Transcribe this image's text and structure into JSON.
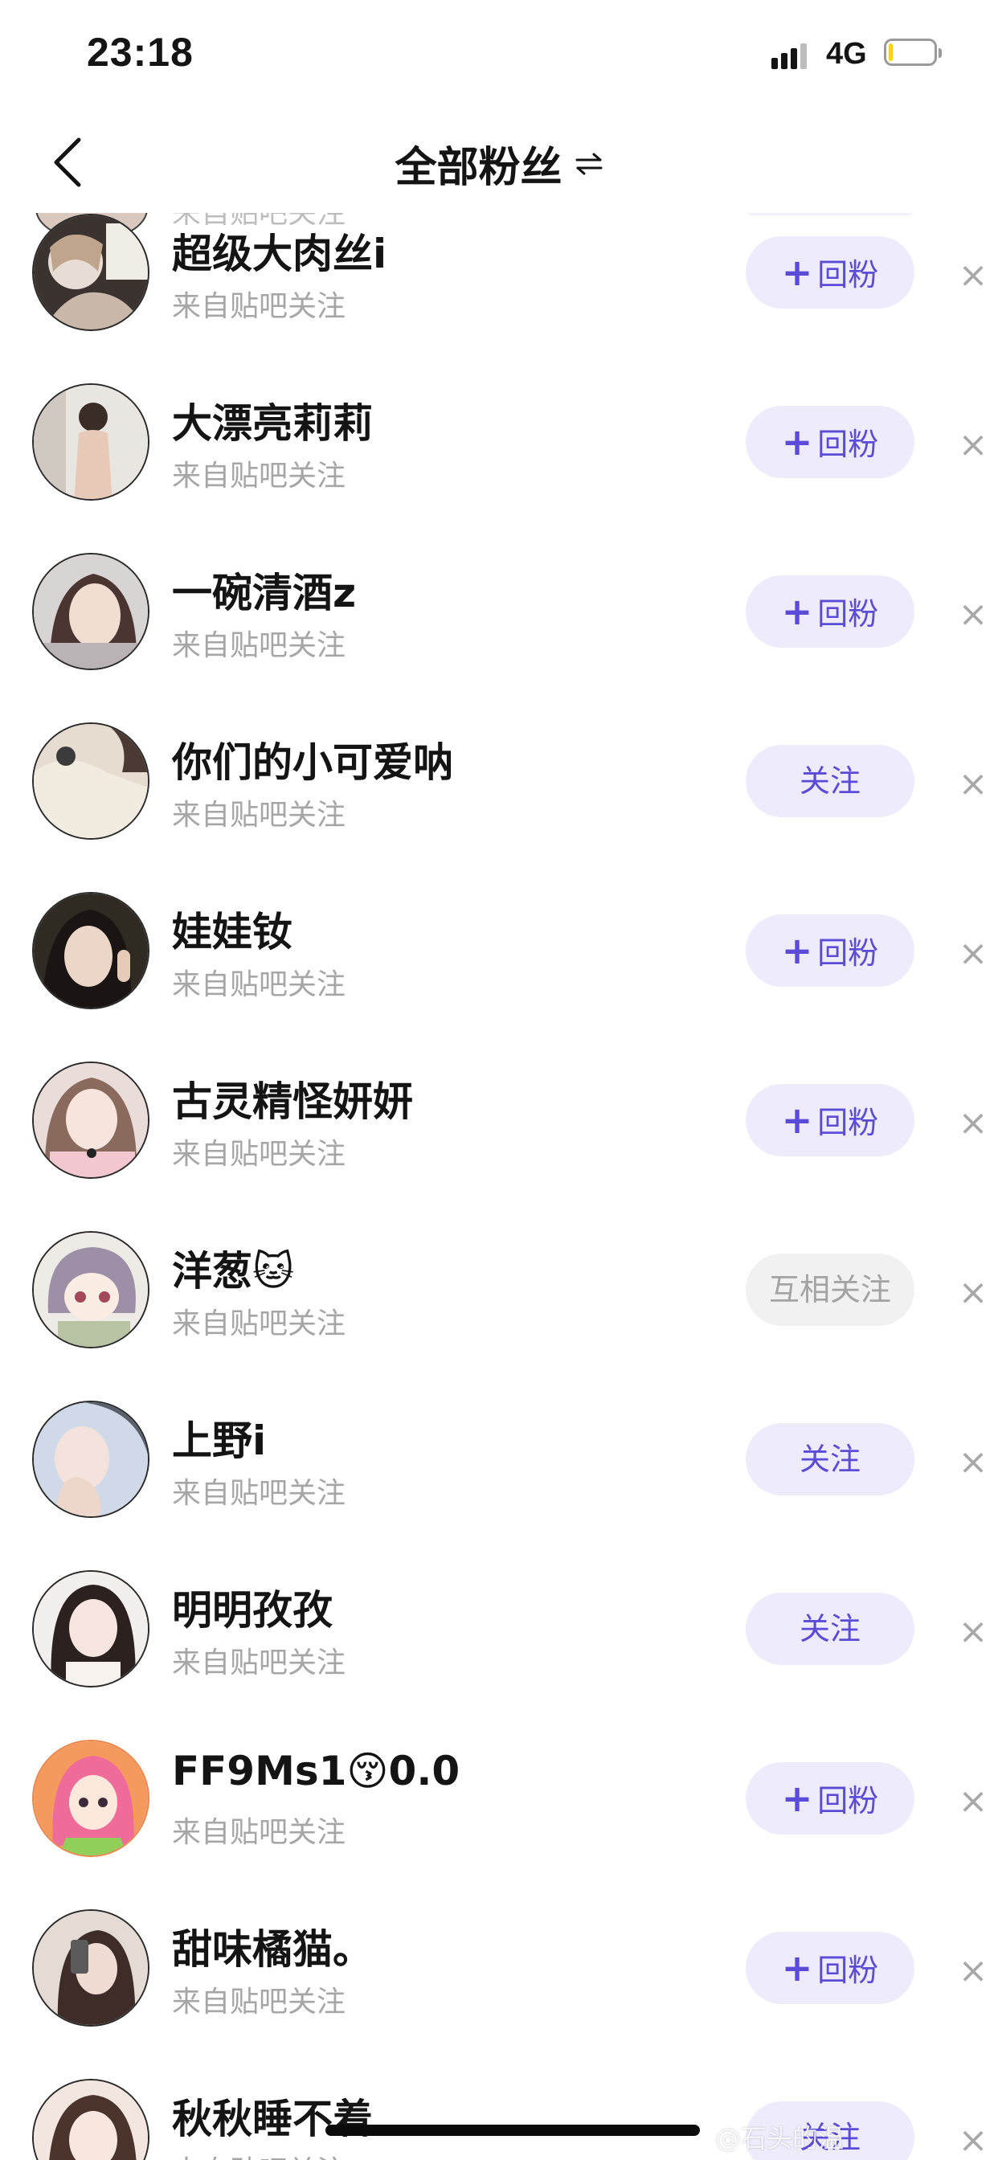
{
  "status_bar": {
    "time": "23:18",
    "network": "4G",
    "battery_level": 0.1,
    "battery_color": "#f3d51f"
  },
  "nav": {
    "back_icon": "chevron-left-icon",
    "title": "全部粉丝",
    "switch_icon": "swap-arrows-icon"
  },
  "colors": {
    "accent": "#5b4bd6",
    "button_bg": "#eeebfc",
    "mutual_bg": "#f1f1f1",
    "mutual_text": "#a3a3a3",
    "secondary_text": "#a6a6a6"
  },
  "followers": [
    {
      "name": "超级大肉丝i",
      "source": "来自贴吧关注",
      "action": "回粉",
      "action_type": "follow-back",
      "remove": "×"
    },
    {
      "name": "大漂亮莉莉",
      "source": "来自贴吧关注",
      "action": "回粉",
      "action_type": "follow-back",
      "remove": "×"
    },
    {
      "name": "一碗清酒z",
      "source": "来自贴吧关注",
      "action": "回粉",
      "action_type": "follow-back",
      "remove": "×"
    },
    {
      "name": "你们的小可爱呐",
      "source": "来自贴吧关注",
      "action": "关注",
      "action_type": "follow",
      "remove": "×"
    },
    {
      "name": "娃娃钕",
      "source": "来自贴吧关注",
      "action": "回粉",
      "action_type": "follow-back",
      "remove": "×"
    },
    {
      "name": "古灵精怪妍妍",
      "source": "来自贴吧关注",
      "action": "回粉",
      "action_type": "follow-back",
      "remove": "×"
    },
    {
      "name": "洋葱🐱",
      "source": "来自贴吧关注",
      "action": "互相关注",
      "action_type": "mutual",
      "remove": "×"
    },
    {
      "name": "上野i",
      "source": "来自贴吧关注",
      "action": "关注",
      "action_type": "follow",
      "remove": "×"
    },
    {
      "name": "明明孜孜",
      "source": "来自贴吧关注",
      "action": "关注",
      "action_type": "follow",
      "remove": "×"
    },
    {
      "name": "FF9Ms1😚0.0",
      "source": "来自贴吧关注",
      "action": "回粉",
      "action_type": "follow-back",
      "remove": "×"
    },
    {
      "name": "甜味橘猫。",
      "source": "来自贴吧关注",
      "action": "回粉",
      "action_type": "follow-back",
      "remove": "×"
    },
    {
      "name": "秋秋睡不着",
      "source": "来自贴吧关注",
      "action": "关注",
      "action_type": "follow",
      "remove": "×"
    }
  ],
  "watermark": "@石头的温"
}
